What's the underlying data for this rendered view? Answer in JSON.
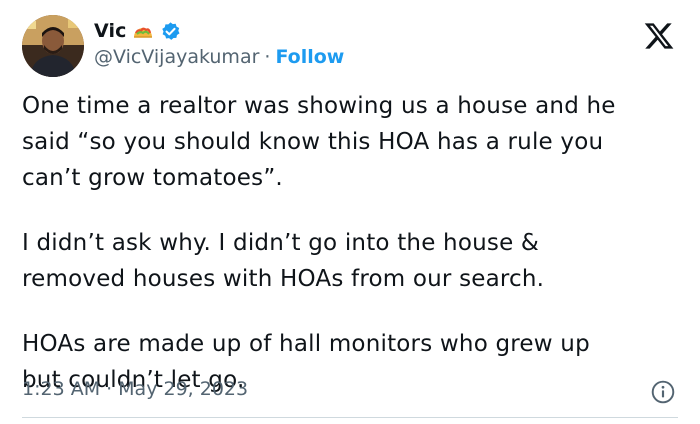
{
  "author": {
    "display_name": "Vic",
    "handle": "@VicVijayakumar",
    "separator": "·",
    "follow_label": "Follow"
  },
  "tweet": {
    "paragraphs": [
      "One time a realtor was showing us a house and he\nsaid “so you should know this HOA has a rule you\ncan’t grow tomatoes”.",
      "I didn’t ask why. I didn’t go into the house &\nremoved houses with HOAs from our search.",
      "HOAs are made up of hall monitors who grew up\nbut couldn’t let go."
    ],
    "time": "1:23 AM",
    "meta_separator": "·",
    "date": "May 29, 2023"
  },
  "icons": {
    "emoji": "taco-icon",
    "badge": "verified-badge-icon",
    "logo": "x-logo-icon",
    "info": "info-icon"
  },
  "colors": {
    "text": "#0f1419",
    "secondary": "#536471",
    "accent": "#1d9bf0",
    "divider": "#cfd9de"
  }
}
